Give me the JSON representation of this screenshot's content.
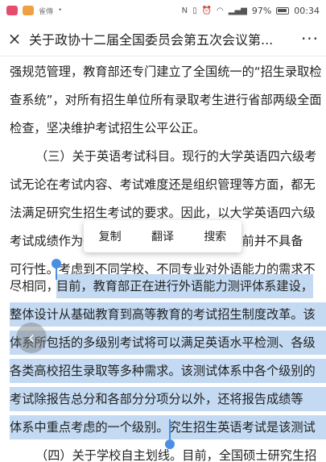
{
  "status_bar": {
    "carrier": "雀傳",
    "dot": "•",
    "battery_percent": "97%",
    "time": "00:34"
  },
  "header": {
    "close_icon": "×",
    "title": "关于政协十二届全国委员会第五次会议第...",
    "more_icon": "···"
  },
  "lines": [
    "强规范管理，教育部还专门建立了全国统一的“招生录取检",
    "查系统”，对所有招生单位所有录取考生进行省部两级全面",
    "检查，坚决维护考试招生公平公正。",
    "（三）关于英语考试科目。现行的大学英语四六级考",
    "试无论在考试内容、考试难度还是组织管理等方面，都无",
    "法满足研究生招生考试的要求。因此，以大学英语四六级",
    "考试成绩作为研究生入学考试英语成绩在目前并不具备",
    "可行性。考虑到不同学校、不同专业对外语能力的需求不",
    "尽相同，",
    "目前，教育部正在进行外语能力测评体系建设，",
    "整体设计从基础教育到高等教育的考试招生制度改革。该",
    "体系所包括的多级别考试将可以满足英语水平检测、各级",
    "各类高校招生录取等多种需求。该测试体系中各个级别的",
    "考试除报告总分和各部分分项分以外，还将报告成绩等",
    "第、学生外语发展水平等。研究生招生英语考试是该测试",
    "体系中重点考虑的一个级别。",
    "（四）关于学校自主划线。目前，全国硕士研究生招"
  ],
  "selection_popup": {
    "copy": "复制",
    "translate": "翻译",
    "search": "搜索"
  },
  "back_icon": "‹",
  "colors": {
    "selection": "#c3daf2",
    "handle": "#4a90e2"
  }
}
